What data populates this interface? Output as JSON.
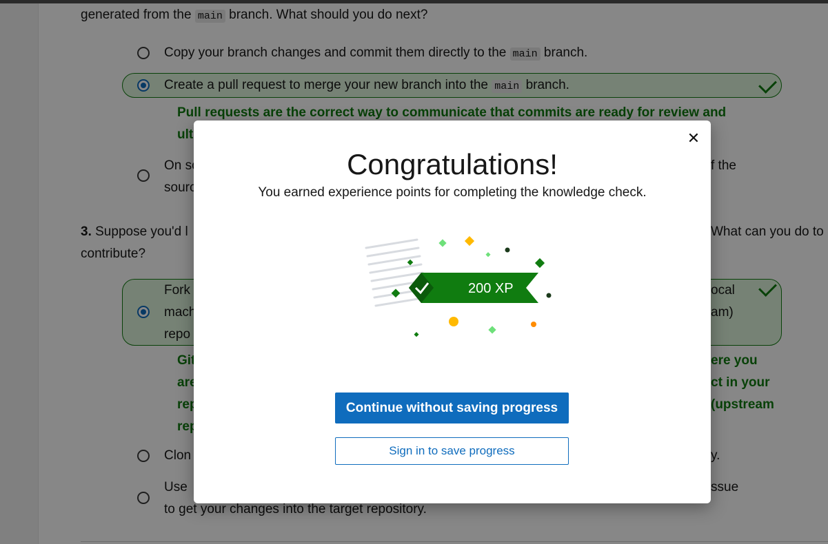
{
  "question2": {
    "prompt_tail_before": "generated from the ",
    "prompt_code": "main",
    "prompt_tail_after": " branch. What should you do next?",
    "options": [
      {
        "before": "Copy your branch changes and commit them directly to the ",
        "code": "main",
        "after": " branch.",
        "selected": false
      },
      {
        "before": "Create a pull request to merge your new branch into the ",
        "code": "main",
        "after": " branch.",
        "selected": true,
        "correct": true
      },
      {
        "line1_left": "On so",
        "line1_right": "f the",
        "line2_left": "sourc",
        "selected": false
      }
    ],
    "explanation_line1": "Pull requests are the correct way to communicate that commits are ready for review and",
    "explanation_line2_left": "ult"
  },
  "question3": {
    "number": "3.",
    "prompt_left": " Suppose you'd l",
    "prompt_right": "What can you do to",
    "prompt_line2": "contribute?",
    "selected_option": {
      "line1_left": "Fork",
      "line1_right": "ocal",
      "line2_left": "mach",
      "line2_right": "am)",
      "line3_left": "repo"
    },
    "explanation": [
      {
        "left": "Git",
        "right": "ere you"
      },
      {
        "left": "are",
        "right": "ct in your"
      },
      {
        "left": "rep",
        "right": "(upstream"
      },
      {
        "left": "rep",
        "right": ""
      }
    ],
    "option_clone": {
      "left": "Clon",
      "right": "y."
    },
    "option_use": {
      "line1_left": "Use",
      "line1_right": "ssue",
      "line2": "to get your changes into the target repository."
    }
  },
  "modal": {
    "close_glyph": "✕",
    "title": "Congratulations!",
    "subtitle": "You earned experience points for completing the knowledge check.",
    "xp_label": "200 XP",
    "primary_button": "Continue without saving progress",
    "secondary_button": "Sign in to save progress"
  },
  "colors": {
    "accent": "#0f6cbd",
    "success": "#107c10",
    "success_bg": "#dff6dd",
    "confetti_gold": "#ffb900",
    "confetti_light_green": "#6ee07a",
    "confetti_dark": "#1b3a1b"
  },
  "icons": [
    "close-icon",
    "checkmark-icon",
    "radio-selected-icon",
    "radio-unselected-icon",
    "xp-badge-icon"
  ]
}
